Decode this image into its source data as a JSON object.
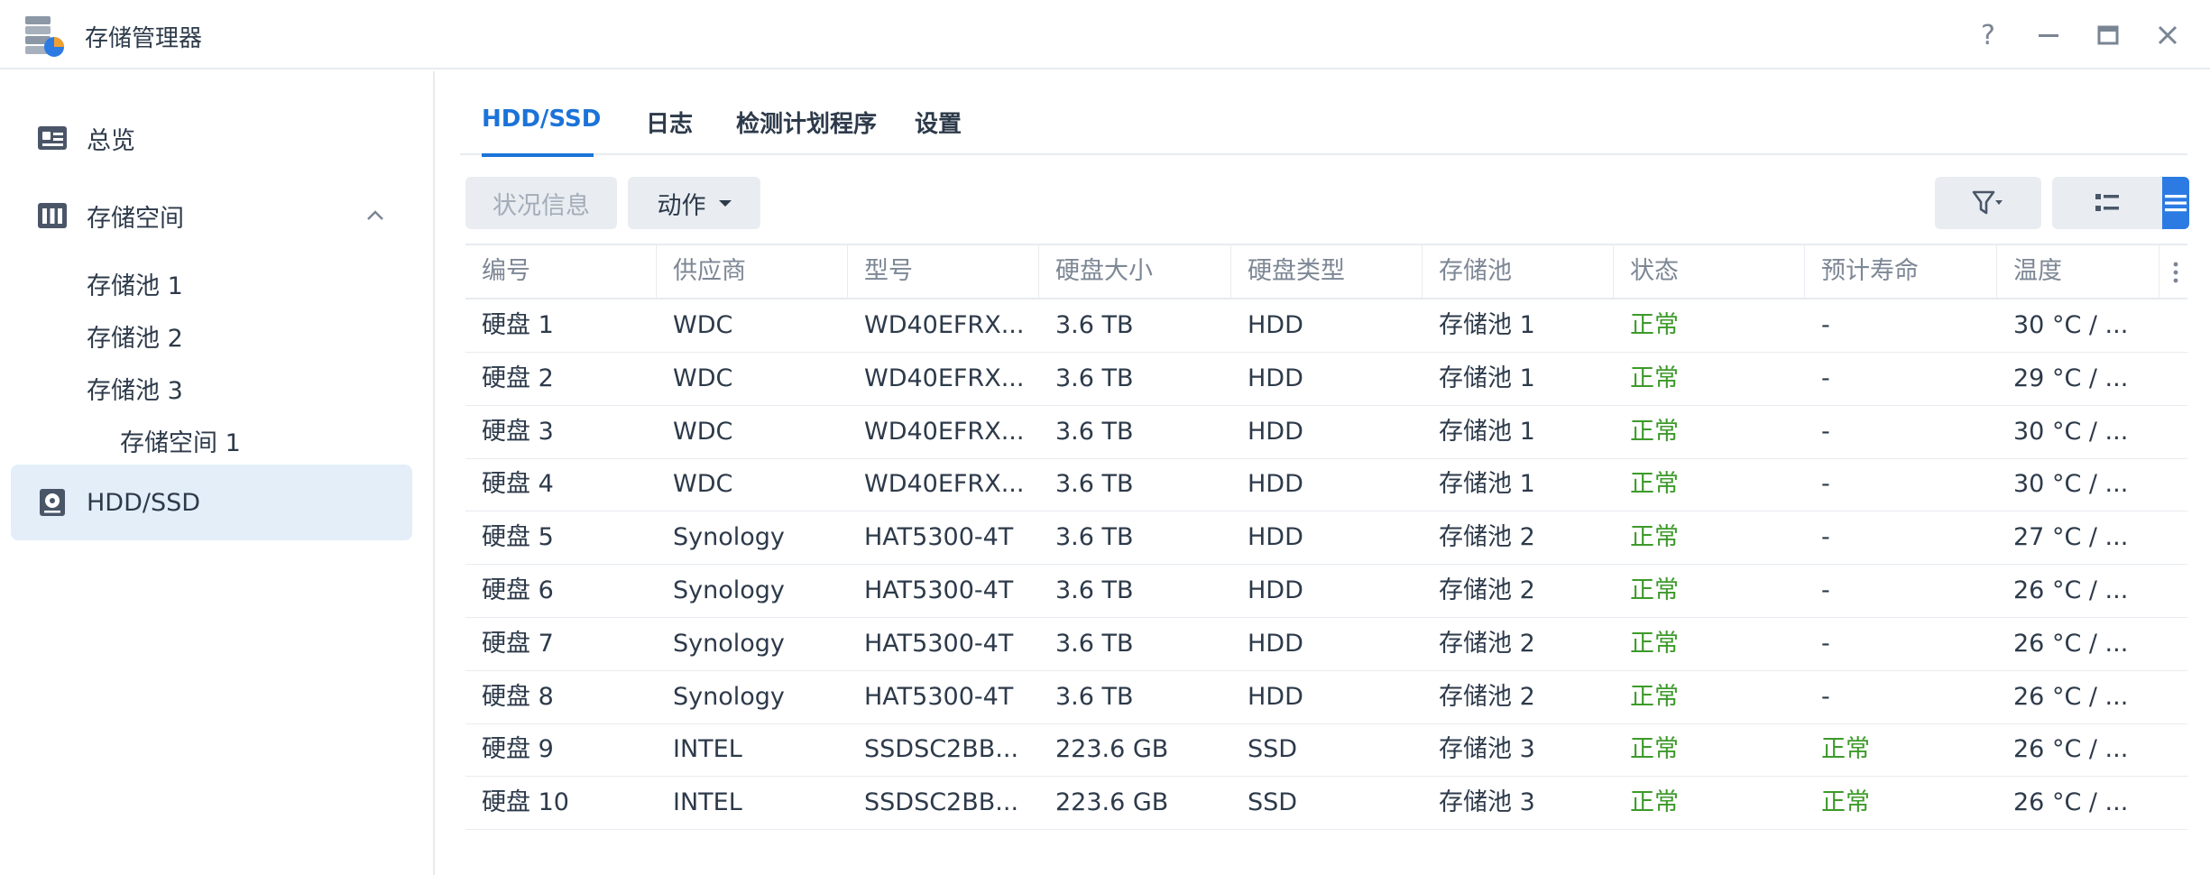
{
  "window": {
    "title": "存储管理器",
    "controls": {
      "help": "?"
    }
  },
  "sidebar": {
    "overview": "总览",
    "storage": "存储空间",
    "pools": [
      "存储池 1",
      "存储池 2",
      "存储池 3"
    ],
    "volumes": [
      "存储空间 1"
    ],
    "hdd": "HDD/SSD"
  },
  "tabs": [
    "HDD/SSD",
    "日志",
    "检测计划程序",
    "设置"
  ],
  "toolbar": {
    "status_label": "状况信息",
    "action_label": "动作"
  },
  "table": {
    "columns": [
      "编号",
      "供应商",
      "型号",
      "硬盘大小",
      "硬盘类型",
      "存储池",
      "状态",
      "预计寿命",
      "温度"
    ],
    "rows": [
      [
        "硬盘 1",
        "WDC",
        "WD40EFRX...",
        "3.6 TB",
        "HDD",
        "存储池 1",
        "正常",
        "-",
        "30 °C / ..."
      ],
      [
        "硬盘 2",
        "WDC",
        "WD40EFRX...",
        "3.6 TB",
        "HDD",
        "存储池 1",
        "正常",
        "-",
        "29 °C / ..."
      ],
      [
        "硬盘 3",
        "WDC",
        "WD40EFRX...",
        "3.6 TB",
        "HDD",
        "存储池 1",
        "正常",
        "-",
        "30 °C / ..."
      ],
      [
        "硬盘 4",
        "WDC",
        "WD40EFRX...",
        "3.6 TB",
        "HDD",
        "存储池 1",
        "正常",
        "-",
        "30 °C / ..."
      ],
      [
        "硬盘 5",
        "Synology",
        "HAT5300-4T",
        "3.6 TB",
        "HDD",
        "存储池 2",
        "正常",
        "-",
        "27 °C / ..."
      ],
      [
        "硬盘 6",
        "Synology",
        "HAT5300-4T",
        "3.6 TB",
        "HDD",
        "存储池 2",
        "正常",
        "-",
        "26 °C / ..."
      ],
      [
        "硬盘 7",
        "Synology",
        "HAT5300-4T",
        "3.6 TB",
        "HDD",
        "存储池 2",
        "正常",
        "-",
        "26 °C / ..."
      ],
      [
        "硬盘 8",
        "Synology",
        "HAT5300-4T",
        "3.6 TB",
        "HDD",
        "存储池 2",
        "正常",
        "-",
        "26 °C / ..."
      ],
      [
        "硬盘 9",
        "INTEL",
        "SSDSC2BB...",
        "223.6 GB",
        "SSD",
        "存储池 3",
        "正常",
        "正常",
        "26 °C / ..."
      ],
      [
        "硬盘 10",
        "INTEL",
        "SSDSC2BB...",
        "223.6 GB",
        "SSD",
        "存储池 3",
        "正常",
        "正常",
        "26 °C / ..."
      ]
    ]
  },
  "colors": {
    "accent": "#1b73d9",
    "ok": "#3d9a2a",
    "active_nav_bg": "#e3eef9"
  }
}
